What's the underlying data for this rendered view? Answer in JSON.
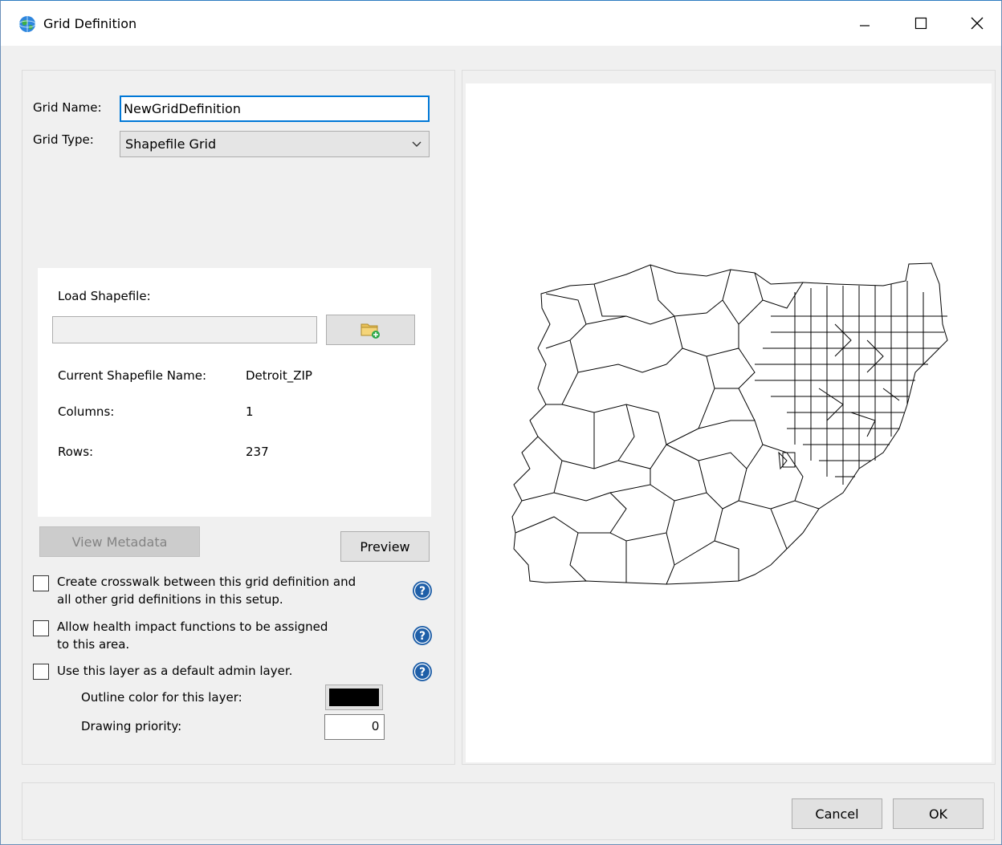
{
  "window": {
    "title": "Grid Definition",
    "icons": {
      "app": "globe-icon",
      "minimize": "minimize-icon",
      "maximize": "maximize-icon",
      "close": "close-icon"
    }
  },
  "form": {
    "grid_name_label": "Grid Name:",
    "grid_name_value": "NewGridDefinition",
    "grid_type_label": "Grid Type:",
    "grid_type_value": "Shapefile Grid"
  },
  "shapefile": {
    "load_label": "Load Shapefile:",
    "path_value": "",
    "current_name_label": "Current Shapefile Name:",
    "current_name_value": "Detroit_ZIP",
    "columns_label": "Columns:",
    "columns_value": "1",
    "rows_label": "Rows:",
    "rows_value": "237",
    "browse_icon": "folder-add-icon"
  },
  "buttons": {
    "view_metadata": "View Metadata",
    "preview": "Preview",
    "cancel": "Cancel",
    "ok": "OK"
  },
  "options": {
    "crosswalk_line1": "Create crosswalk between this grid definition and",
    "crosswalk_line2": "all other grid definitions in this setup.",
    "health_line1": "Allow health impact functions to be assigned",
    "health_line2": "to this area.",
    "admin_layer": "Use this layer as a default admin layer.",
    "outline_color_label": "Outline color for this layer:",
    "outline_color": "#000000",
    "drawing_priority_label": "Drawing priority:",
    "drawing_priority_value": "0",
    "help_icon": "help-icon"
  },
  "colors": {
    "accent": "#0078d7",
    "help_blue": "#1f5fa8"
  }
}
